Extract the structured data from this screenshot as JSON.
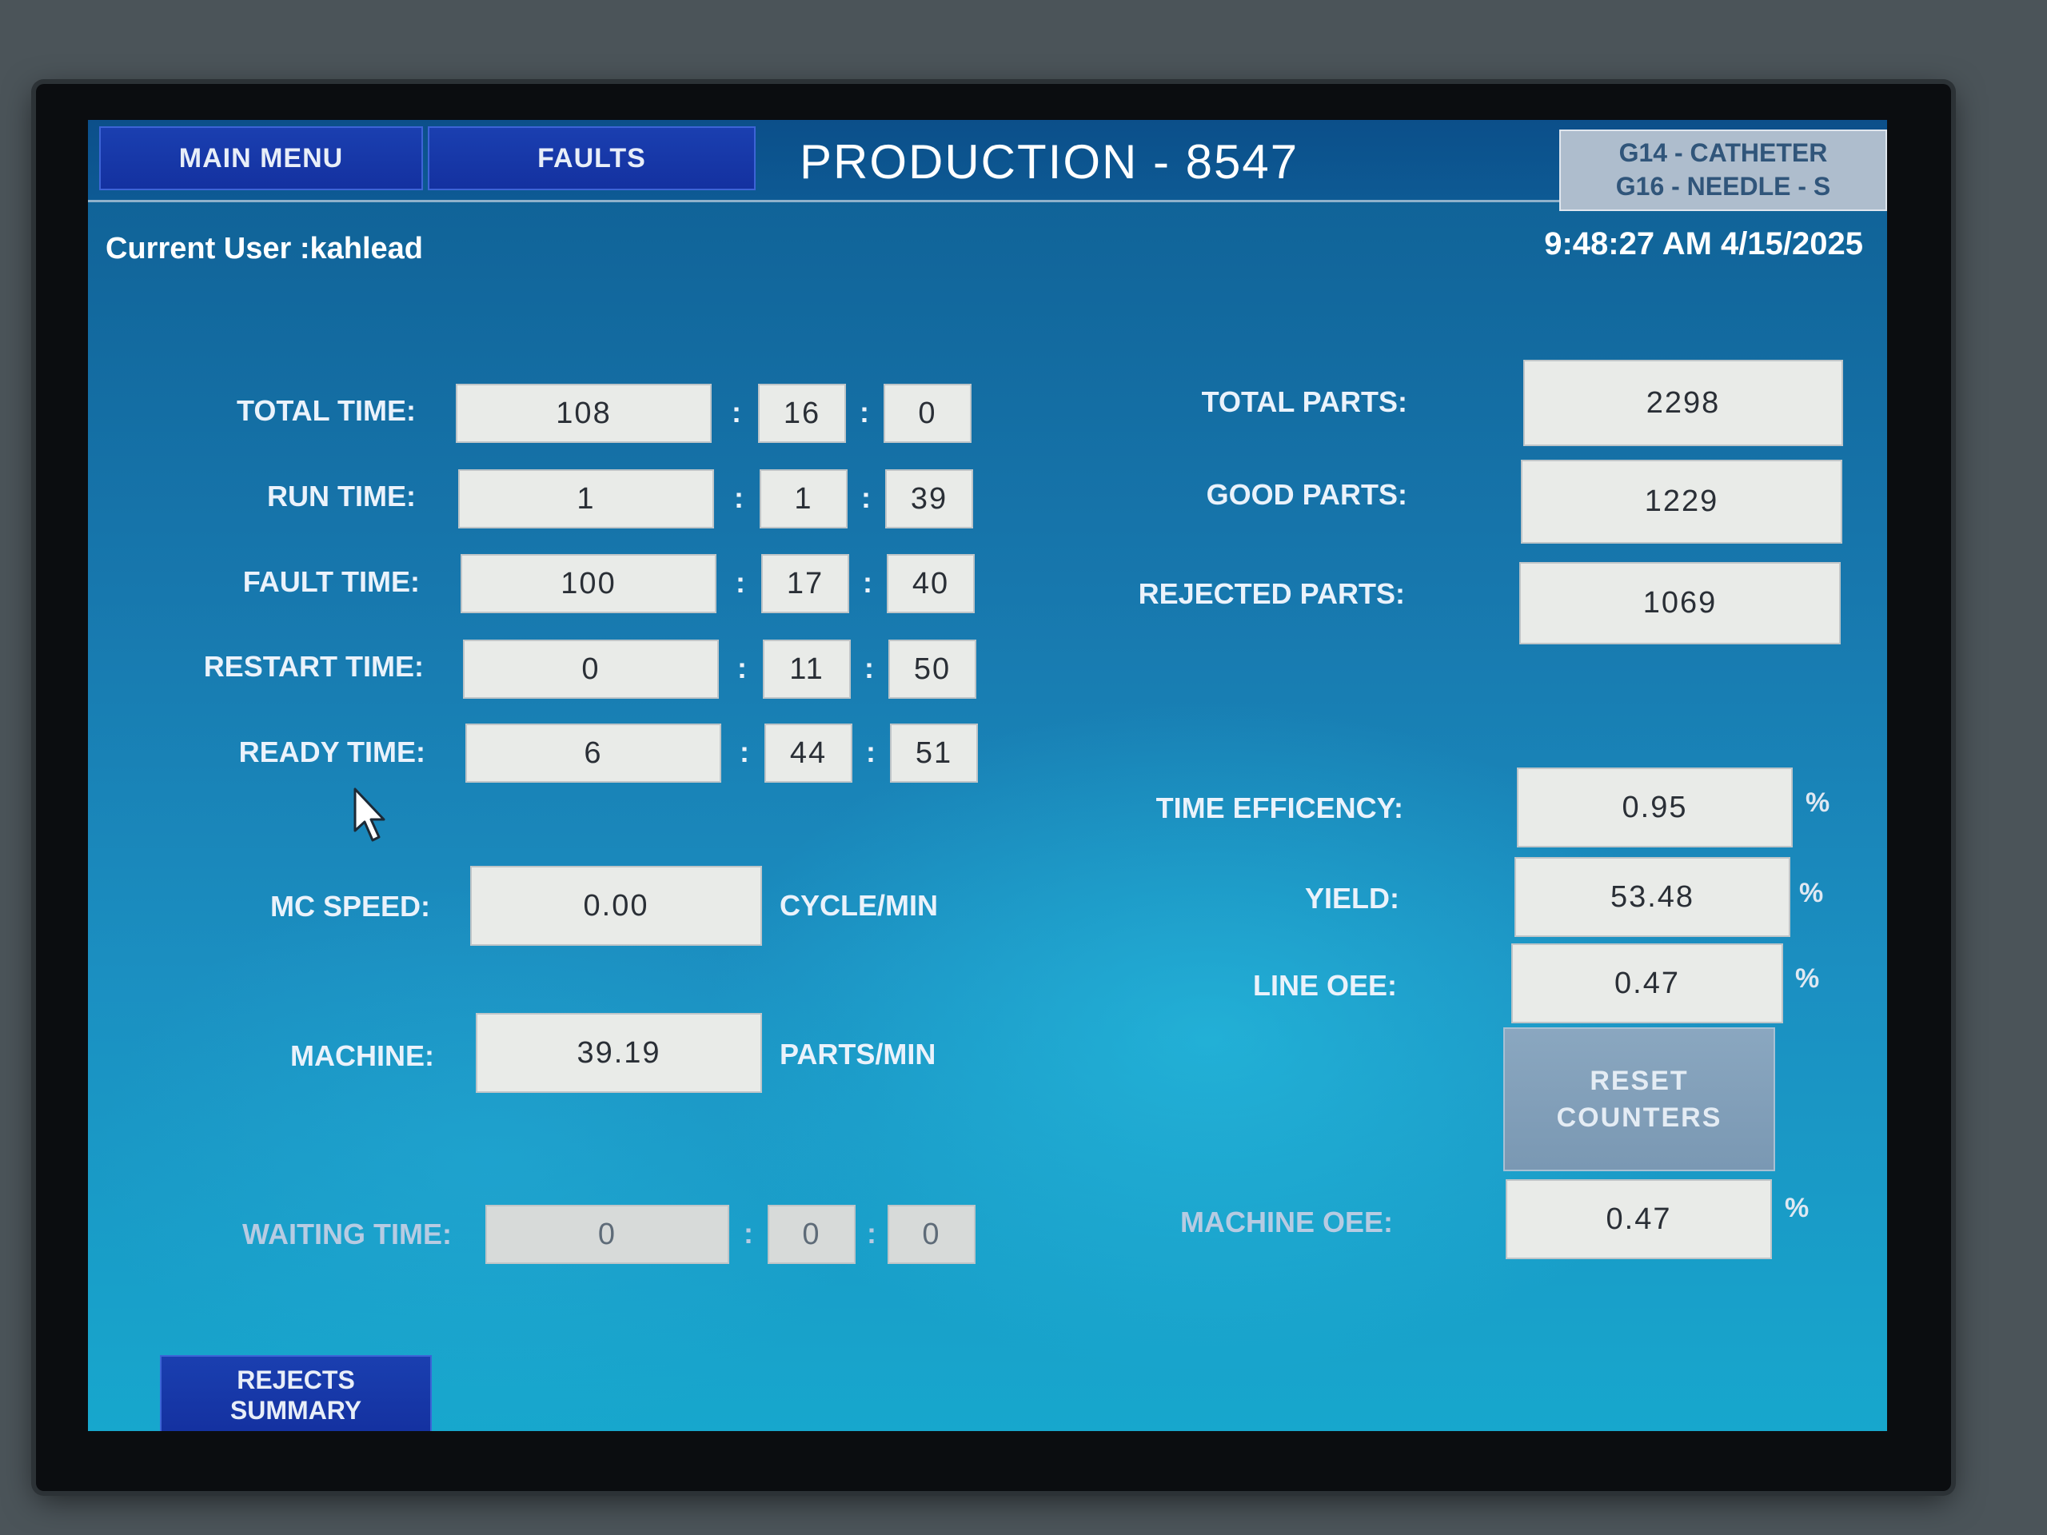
{
  "header": {
    "main_menu": "MAIN MENU",
    "faults": "FAULTS",
    "title": "PRODUCTION - 8547",
    "product_line1": "G14 - CATHETER",
    "product_line2": "G16 - NEEDLE - S"
  },
  "status": {
    "current_user": "Current User :kahlead",
    "datetime": "9:48:27 AM 4/15/2025"
  },
  "times": {
    "total": {
      "label": "TOTAL TIME:",
      "h": "108",
      "m": "16",
      "s": "0"
    },
    "run": {
      "label": "RUN TIME:",
      "h": "1",
      "m": "1",
      "s": "39"
    },
    "fault": {
      "label": "FAULT TIME:",
      "h": "100",
      "m": "17",
      "s": "40"
    },
    "restart": {
      "label": "RESTART TIME:",
      "h": "0",
      "m": "11",
      "s": "50"
    },
    "ready": {
      "label": "READY TIME:",
      "h": "6",
      "m": "44",
      "s": "51"
    },
    "waiting": {
      "label": "WAITING TIME:",
      "h": "0",
      "m": "0",
      "s": "0"
    },
    "separator": ":"
  },
  "speed": {
    "mc_label": "MC SPEED:",
    "mc_value": "0.00",
    "mc_unit": "CYCLE/MIN",
    "machine_label": "MACHINE:",
    "machine_value": "39.19",
    "machine_unit": "PARTS/MIN"
  },
  "parts": {
    "total_label": "TOTAL PARTS:",
    "total": "2298",
    "good_label": "GOOD PARTS:",
    "good": "1229",
    "rejected_label": "REJECTED PARTS:",
    "rejected": "1069"
  },
  "metrics": {
    "time_eff_label": "TIME EFFICENCY:",
    "time_eff": "0.95",
    "yield_label": "YIELD:",
    "yield": "53.48",
    "line_oee_label": "LINE OEE:",
    "line_oee": "0.47",
    "machine_oee_label": "MACHINE OEE:",
    "machine_oee": "0.47",
    "percent": "%"
  },
  "buttons": {
    "reset_line1": "RESET",
    "reset_line2": "COUNTERS",
    "rejects_line1": "REJECTS",
    "rejects_line2": "SUMMARY"
  },
  "icons": {
    "cursor": "mouse-pointer-icon"
  }
}
